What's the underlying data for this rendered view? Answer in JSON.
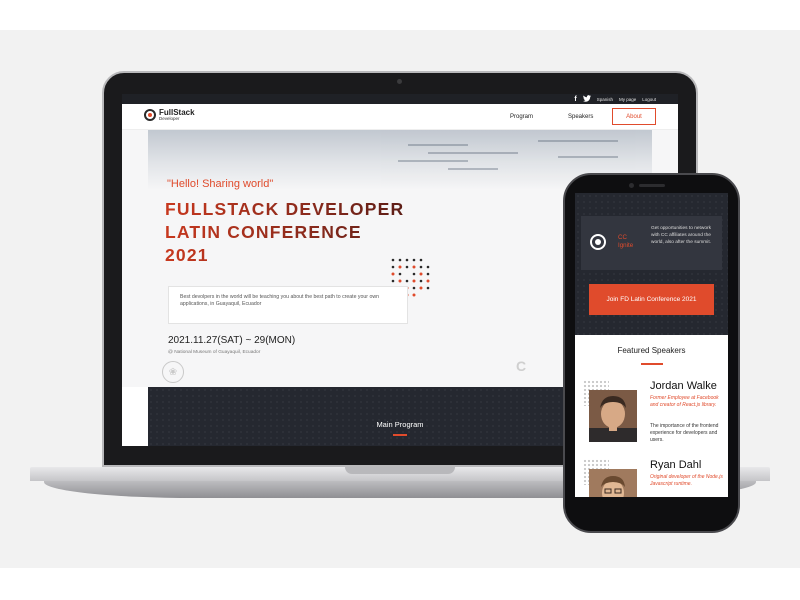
{
  "laptop_site": {
    "topbar": {
      "links": [
        "Spanish",
        "My page",
        "Logout"
      ]
    },
    "logo": {
      "title": "FullStack",
      "subtitle": "Developer"
    },
    "nav": {
      "program": "Program",
      "speakers": "Speakers",
      "about": "About"
    },
    "hero": {
      "tagline": "\"Hello! Sharing world\"",
      "title_lines": [
        "FULLSTACK DEVELOPER",
        "LATIN CONFERENCE",
        "2021"
      ],
      "description": "Best devolpers in the world will be teaching you about the best path to create your own applications, in Guayaquil, Ecuador",
      "date": "2021.11.27(SAT) ~ 29(MON)",
      "venue": "@ National Museum of Guayaquil, Ecuador"
    },
    "program_section": {
      "title": "Main Program"
    }
  },
  "phone_site": {
    "affiliate_card": {
      "name_line1": "CC",
      "name_line2": "Ignite",
      "text": "Get opportunities to network with CC affiliates around the world, also after the summit."
    },
    "join_button": "Join FD Latin Conference 2021",
    "featured_title": "Featured Speakers",
    "speakers": [
      {
        "name": "Jordan Walke",
        "role": "Former Employee at Facebook and creator of React.js library.",
        "talk": "The importance of the frontend experience for developers and users."
      },
      {
        "name": "Ryan Dahl",
        "role": "Original developer of the Node.js Javascript runtime."
      }
    ]
  },
  "colors": {
    "accent": "#e04b2c",
    "dark_section": "#252830",
    "title_dark": "#5d1d16"
  },
  "icons": [
    "facebook-icon",
    "twitter-icon",
    "logo-icon",
    "cc-ignite-icon"
  ]
}
